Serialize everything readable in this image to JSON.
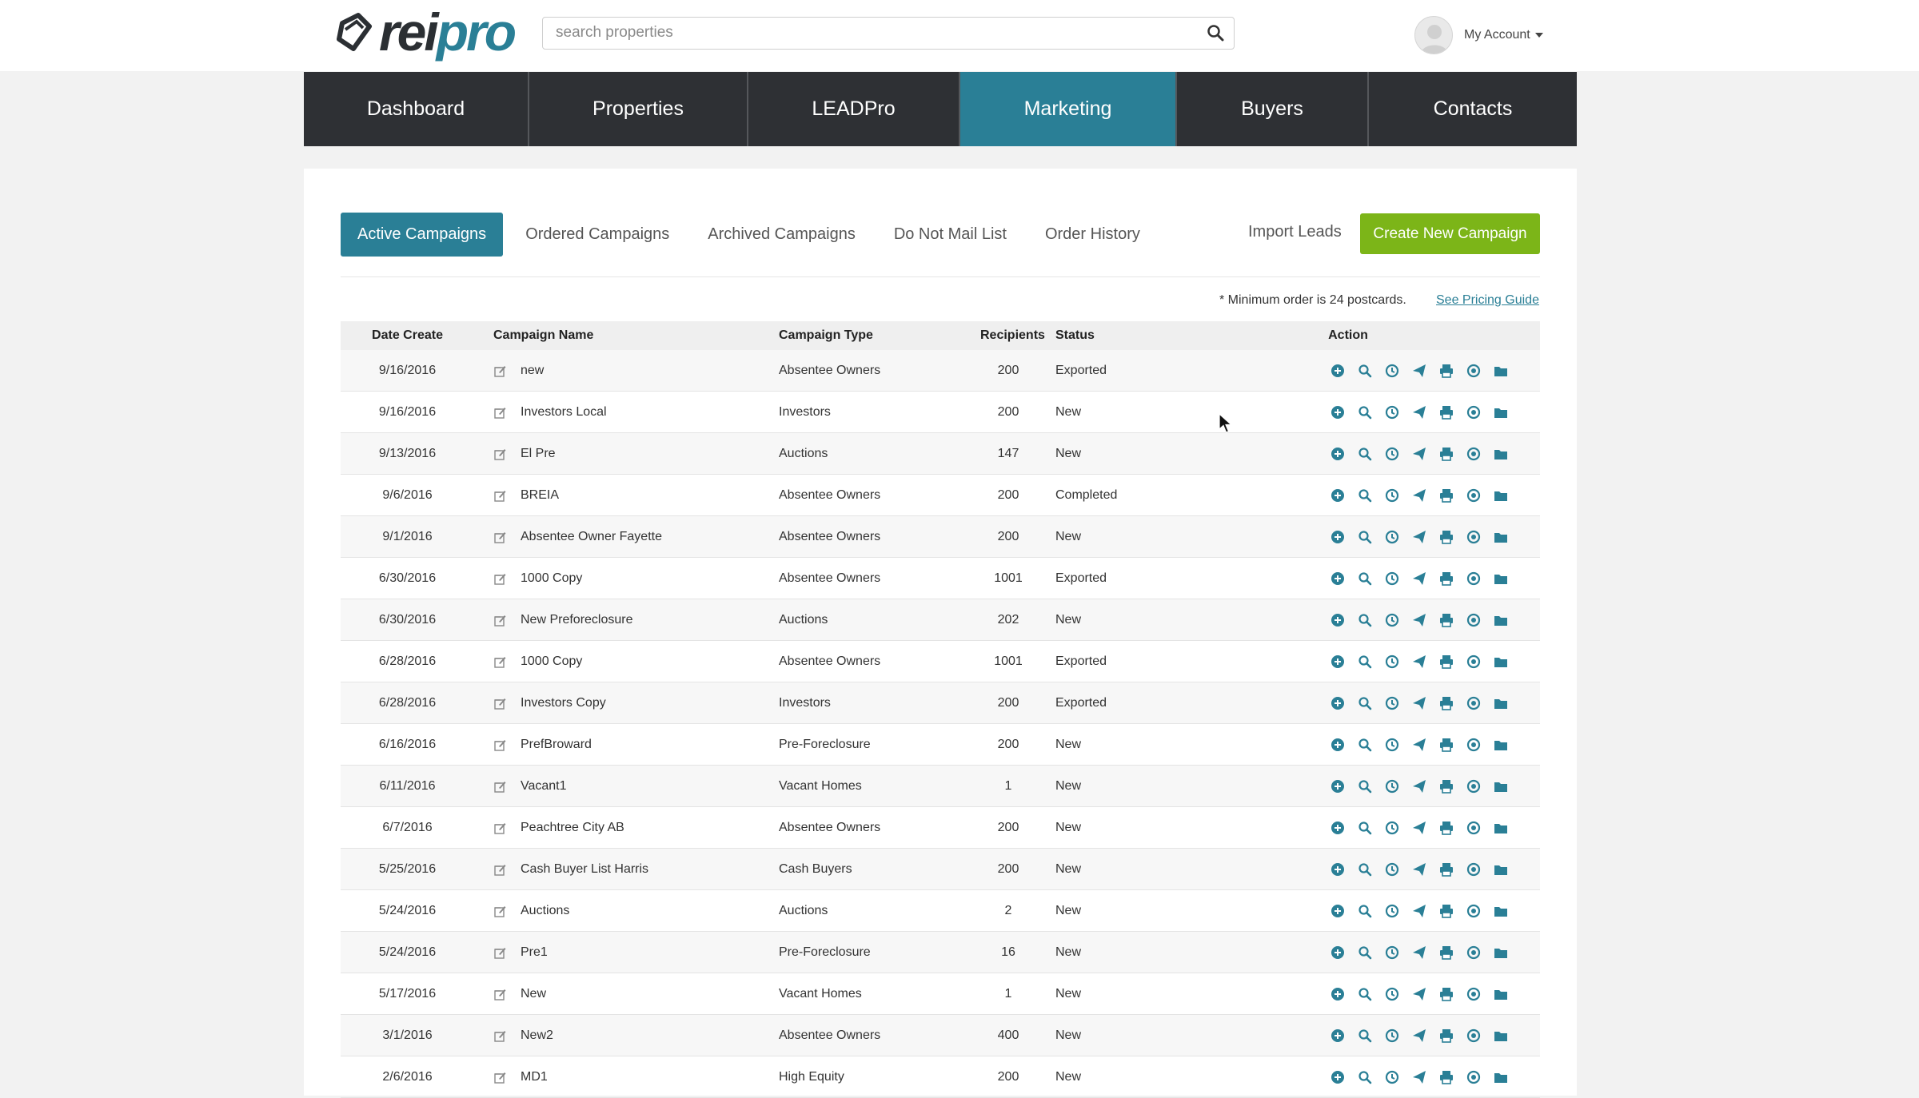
{
  "header": {
    "logo": {
      "rei": "rei",
      "pro": "pro"
    },
    "search_placeholder": "search properties",
    "account_label": "My Account"
  },
  "nav": [
    "Dashboard",
    "Properties",
    "LEADPro",
    "Marketing",
    "Buyers",
    "Contacts"
  ],
  "nav_active": "Marketing",
  "tabs": [
    "Active Campaigns",
    "Ordered Campaigns",
    "Archived Campaigns",
    "Do Not Mail List",
    "Order History"
  ],
  "tab_active": "Active Campaigns",
  "actions": {
    "import_leads": "Import Leads",
    "create_campaign": "Create New Campaign"
  },
  "notice": {
    "min_order": "* Minimum order is 24 postcards.",
    "pricing_link": "See Pricing Guide"
  },
  "table": {
    "headers": {
      "date": "Date Create",
      "name": "Campaign Name",
      "type": "Campaign Type",
      "recipients": "Recipients",
      "status": "Status",
      "action": "Action"
    },
    "rows": [
      {
        "date": "9/16/2016",
        "name": "new",
        "type": "Absentee Owners",
        "recipients": "200",
        "status": "Exported"
      },
      {
        "date": "9/16/2016",
        "name": "Investors Local",
        "type": "Investors",
        "recipients": "200",
        "status": "New"
      },
      {
        "date": "9/13/2016",
        "name": "El Pre",
        "type": "Auctions",
        "recipients": "147",
        "status": "New"
      },
      {
        "date": "9/6/2016",
        "name": "BREIA",
        "type": "Absentee Owners",
        "recipients": "200",
        "status": "Completed"
      },
      {
        "date": "9/1/2016",
        "name": "Absentee Owner Fayette",
        "type": "Absentee Owners",
        "recipients": "200",
        "status": "New"
      },
      {
        "date": "6/30/2016",
        "name": "1000 Copy",
        "type": "Absentee Owners",
        "recipients": "1001",
        "status": "Exported"
      },
      {
        "date": "6/30/2016",
        "name": "New Preforeclosure",
        "type": "Auctions",
        "recipients": "202",
        "status": "New"
      },
      {
        "date": "6/28/2016",
        "name": "1000 Copy",
        "type": "Absentee Owners",
        "recipients": "1001",
        "status": "Exported"
      },
      {
        "date": "6/28/2016",
        "name": "Investors Copy",
        "type": "Investors",
        "recipients": "200",
        "status": "Exported"
      },
      {
        "date": "6/16/2016",
        "name": "PrefBroward",
        "type": "Pre-Foreclosure",
        "recipients": "200",
        "status": "New"
      },
      {
        "date": "6/11/2016",
        "name": "Vacant1",
        "type": "Vacant Homes",
        "recipients": "1",
        "status": "New"
      },
      {
        "date": "6/7/2016",
        "name": "Peachtree City AB",
        "type": "Absentee Owners",
        "recipients": "200",
        "status": "New"
      },
      {
        "date": "5/25/2016",
        "name": "Cash Buyer List Harris",
        "type": "Cash Buyers",
        "recipients": "200",
        "status": "New"
      },
      {
        "date": "5/24/2016",
        "name": "Auctions",
        "type": "Auctions",
        "recipients": "2",
        "status": "New"
      },
      {
        "date": "5/24/2016",
        "name": "Pre1",
        "type": "Pre-Foreclosure",
        "recipients": "16",
        "status": "New"
      },
      {
        "date": "5/17/2016",
        "name": "New",
        "type": "Vacant Homes",
        "recipients": "1",
        "status": "New"
      },
      {
        "date": "3/1/2016",
        "name": "New2",
        "type": "Absentee Owners",
        "recipients": "400",
        "status": "New"
      },
      {
        "date": "2/6/2016",
        "name": "MD1",
        "type": "High Equity",
        "recipients": "200",
        "status": "New"
      }
    ],
    "row_action_icons": [
      "plus-circle-icon",
      "search-icon",
      "clock-icon",
      "send-icon",
      "print-icon",
      "cancel-circle-icon",
      "folder-icon"
    ]
  },
  "colors": {
    "accent": "#2a7f96",
    "nav_bg": "#2e3034",
    "create_button": "#7cb518"
  }
}
